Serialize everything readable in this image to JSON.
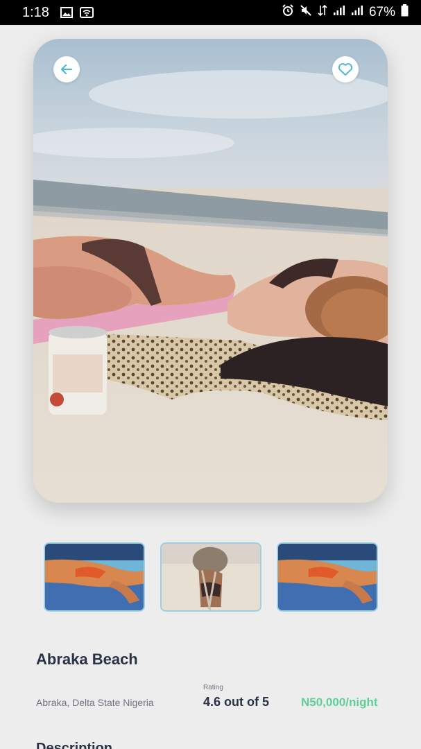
{
  "status_bar": {
    "time": "1:18",
    "battery": "67%",
    "icons": [
      "image-icon",
      "wifi-icon",
      "alarm-icon",
      "mute-icon",
      "data-icon",
      "signal-icon",
      "signal-icon",
      "battery-icon"
    ]
  },
  "hero": {
    "back_icon": "arrow-left-icon",
    "favorite_icon": "heart-outline-icon",
    "accent": "#4fb8d8"
  },
  "thumbnails": [
    {
      "name": "thumbnail-1"
    },
    {
      "name": "thumbnail-2"
    },
    {
      "name": "thumbnail-3"
    }
  ],
  "place": {
    "title": "Abraka Beach",
    "location": "Abraka, Delta State Nigeria",
    "rating_label": "Rating",
    "rating_value": "4.6 out of 5",
    "price": "N50,000/night"
  },
  "description": {
    "heading": "Description"
  },
  "colors": {
    "background": "#ededed",
    "title": "#2a3247",
    "muted": "#6f7380",
    "price": "#5fd095",
    "accent": "#4fb8d8"
  }
}
